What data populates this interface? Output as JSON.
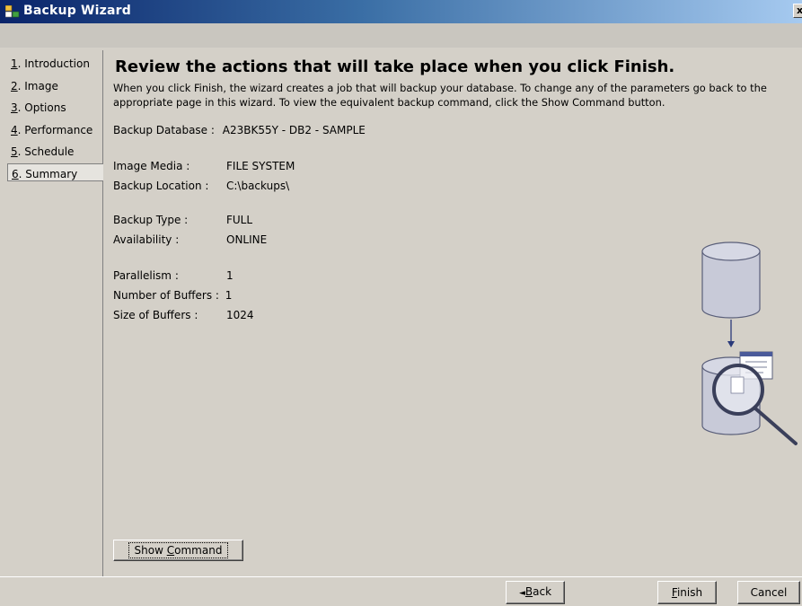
{
  "window": {
    "title": "Backup Wizard",
    "close_label": "x"
  },
  "nav": {
    "items": [
      {
        "num": "1",
        "label": ". Introduction"
      },
      {
        "num": "2",
        "label": ". Image"
      },
      {
        "num": "3",
        "label": ". Options"
      },
      {
        "num": "4",
        "label": ". Performance"
      },
      {
        "num": "5",
        "label": ". Schedule"
      },
      {
        "num": "6",
        "label": ". Summary"
      }
    ],
    "active_index": 5
  },
  "main": {
    "heading": "Review the actions that will take place when you click Finish.",
    "description": "When you click Finish, the wizard creates a job that will backup your database.  To change any of the parameters go back to the appropriate page in this wizard.  To view the equivalent backup command, click the Show Command button.",
    "summary": {
      "database": {
        "label": "Backup Database :",
        "value": "A23BK55Y - DB2 - SAMPLE"
      },
      "image_media": {
        "label": "Image Media :",
        "value": "FILE SYSTEM"
      },
      "location": {
        "label": "Backup Location :",
        "value": "C:\\backups\\"
      },
      "type": {
        "label": "Backup Type :",
        "value": "FULL"
      },
      "availability": {
        "label": "Availability :",
        "value": "ONLINE"
      },
      "parallelism": {
        "label": "Parallelism :",
        "value": "1"
      },
      "num_buffers": {
        "label": "Number of Buffers :",
        "value": "1"
      },
      "buffer_size": {
        "label": "Size of Buffers :",
        "value": "1024"
      }
    },
    "show_command": {
      "pre": "Show ",
      "mnemonic": "C",
      "post": "ommand"
    }
  },
  "footer": {
    "back": {
      "arrow": "◄",
      "mnemonic": "B",
      "post": "ack"
    },
    "finish": {
      "mnemonic": "F",
      "post": "inish"
    },
    "cancel": "Cancel"
  },
  "icons": {
    "title": "wizard-app-icon",
    "illustration": "database-backup-illustration",
    "close": "close-icon"
  },
  "colors": {
    "titlebar_start": "#0a246a",
    "titlebar_end": "#a6caf0",
    "face": "#d4d0c8",
    "cylinder": "#c8cad8"
  }
}
